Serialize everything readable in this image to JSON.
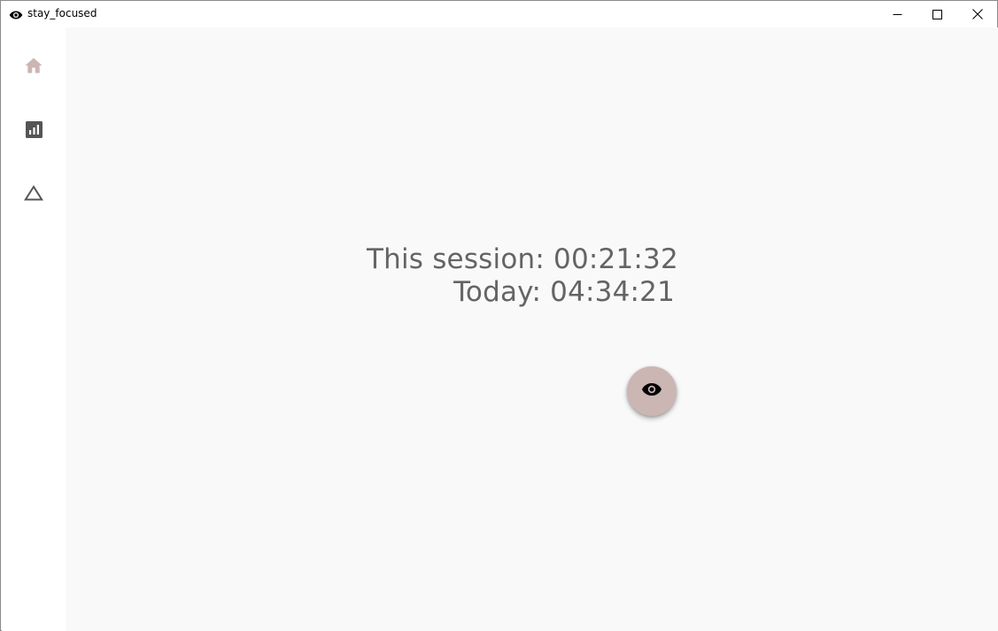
{
  "window": {
    "title": "stay_focused",
    "app_icon": "eye-icon"
  },
  "window_controls": {
    "minimize_icon": "minimize-icon",
    "maximize_icon": "maximize-icon",
    "close_icon": "close-icon"
  },
  "nav": {
    "items": [
      {
        "icon": "home-icon",
        "selected": true,
        "color": "#cbb6b4"
      },
      {
        "icon": "bar-chart-icon",
        "selected": false,
        "color": "#555555"
      },
      {
        "icon": "triangle-icon",
        "selected": false,
        "color": "#555555"
      }
    ]
  },
  "main": {
    "session_line": "This session: 00:21:32",
    "today_line": "Today: 04:34:21"
  },
  "fab": {
    "icon": "eye-icon",
    "color": "#cbb6b4"
  },
  "colors": {
    "accent": "#cbb6b4",
    "background": "#f9f9f9",
    "text": "#646464"
  }
}
